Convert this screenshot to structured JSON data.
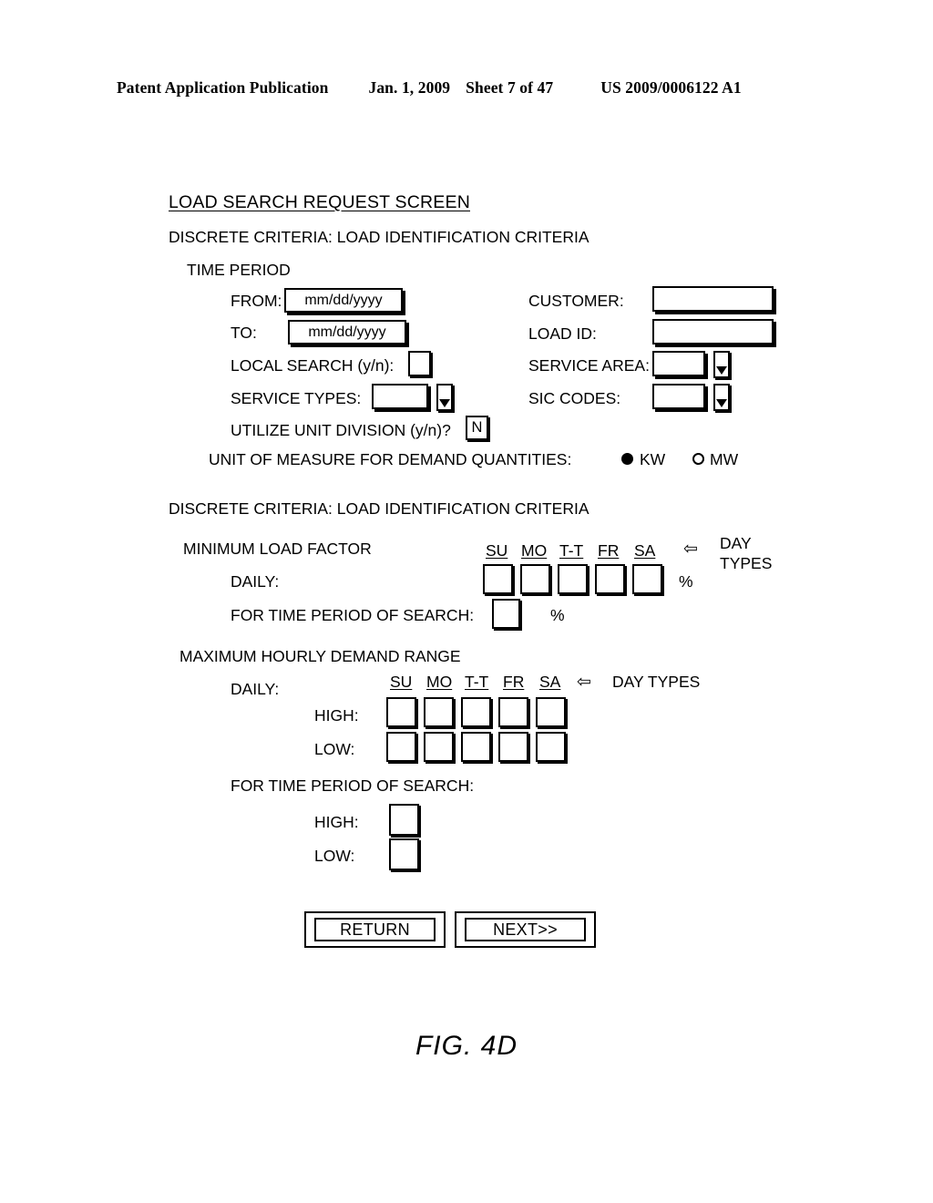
{
  "patent_header": {
    "publication": "Patent Application Publication",
    "date": "Jan. 1, 2009",
    "sheet": "Sheet 7 of 47",
    "number": "US 2009/0006122 A1"
  },
  "screen": {
    "title": "LOAD SEARCH REQUEST SCREEN",
    "section1_heading": "DISCRETE CRITERIA: LOAD IDENTIFICATION CRITERIA",
    "time_period_label": "TIME PERIOD",
    "fields": {
      "from_label": "FROM:",
      "from_value": "mm/dd/yyyy",
      "to_label": "TO:",
      "to_value": "mm/dd/yyyy",
      "local_search_label": "LOCAL SEARCH (y/n):",
      "local_search_value": "",
      "service_types_label": "SERVICE TYPES:",
      "service_types_value": "",
      "utilize_unit_division_label": "UTILIZE UNIT DIVISION (y/n)?",
      "utilize_unit_division_value": "N",
      "customer_label": "CUSTOMER:",
      "customer_value": "",
      "load_id_label": "LOAD ID:",
      "load_id_value": "",
      "service_area_label": "SERVICE AREA:",
      "service_area_value": "",
      "sic_codes_label": "SIC CODES:",
      "sic_codes_value": ""
    },
    "unit_of_measure": {
      "label": "UNIT OF MEASURE FOR DEMAND QUANTITIES:",
      "option_kw": "KW",
      "option_mw": "MW",
      "selected": "KW"
    },
    "section2_heading": "DISCRETE CRITERIA: LOAD IDENTIFICATION CRITERIA",
    "minimum_load_factor": {
      "heading": "MINIMUM LOAD FACTOR",
      "daily_label": "DAILY:",
      "time_period_label": "FOR TIME PERIOD OF SEARCH:",
      "percent_symbol": "%",
      "day_types": [
        "SU",
        "MO",
        "T-T",
        "FR",
        "SA"
      ],
      "day_types_caption_line1": "DAY",
      "day_types_caption_line2": "TYPES",
      "arrow": "←",
      "daily_values": [
        "",
        "",
        "",
        "",
        ""
      ],
      "time_period_value": ""
    },
    "maximum_hourly_demand_range": {
      "heading": "MAXIMUM HOURLY DEMAND RANGE",
      "daily_label": "DAILY:",
      "high_label": "HIGH:",
      "low_label": "LOW:",
      "day_types": [
        "SU",
        "MO",
        "T-T",
        "FR",
        "SA"
      ],
      "day_types_caption": "DAY TYPES",
      "arrow": "←",
      "high_values": [
        "",
        "",
        "",
        "",
        ""
      ],
      "low_values": [
        "",
        "",
        "",
        "",
        ""
      ],
      "time_period_label": "FOR TIME PERIOD OF SEARCH:",
      "tp_high_label": "HIGH:",
      "tp_low_label": "LOW:",
      "tp_high_value": "",
      "tp_low_value": ""
    },
    "buttons": {
      "return_label": "RETURN",
      "next_label": "NEXT>>"
    }
  },
  "figure_caption": "FIG. 4D"
}
